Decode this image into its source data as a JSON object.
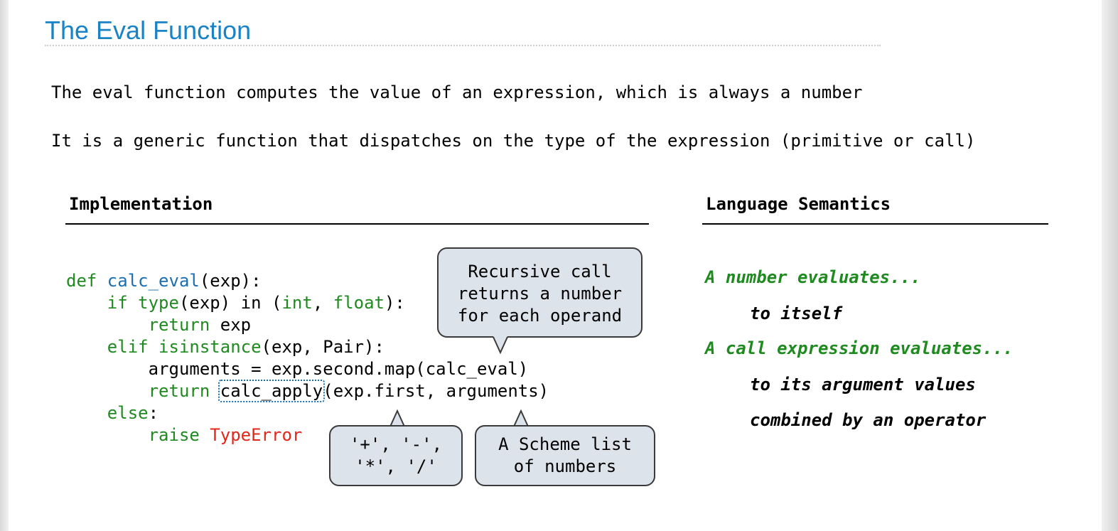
{
  "title": "The Eval Function",
  "intro": {
    "line1": "The eval function computes the value of an expression, which is always a number",
    "line2": "It is a generic function that dispatches on the type of the expression (primitive or call)"
  },
  "implementation": {
    "heading": "Implementation",
    "code": {
      "l1": {
        "a": "def ",
        "b": "calc_eval",
        "c": "(exp):"
      },
      "l2": {
        "a": "    if ",
        "b": "type",
        "c": "(exp) ",
        "d": "in",
        "e": " (",
        "f": "int",
        "g": ", ",
        "h": "float",
        "i": "):"
      },
      "l3": {
        "a": "        return",
        "b": " exp"
      },
      "l4": {
        "a": "    elif ",
        "b": "isinstance",
        "c": "(exp, Pair):"
      },
      "l5": {
        "a": "        arguments = exp.second.map(calc_eval)"
      },
      "l6": {
        "a": "        return",
        "b": " ",
        "c": "calc_apply",
        "d": "(exp.first, arguments)"
      },
      "l7": {
        "a": "    else",
        "b": ":"
      },
      "l8": {
        "a": "        raise ",
        "b": "TypeError"
      }
    },
    "callouts": {
      "recursive": "Recursive call\nreturns a number\nfor each operand",
      "operators": "'+', '-',\n'*', '/'",
      "scheme_list": "A Scheme list\nof numbers"
    }
  },
  "semantics": {
    "heading": "Language Semantics",
    "items": [
      "A number evaluates...",
      "to itself",
      "A call expression evaluates...",
      "to its argument values",
      "combined by an operator"
    ]
  },
  "colors": {
    "title": "#1a83c6",
    "keyword": "#1f8a1f",
    "function_name": "#1a6fb2",
    "error": "#e0281a",
    "bubble_fill": "#dde3ea"
  }
}
